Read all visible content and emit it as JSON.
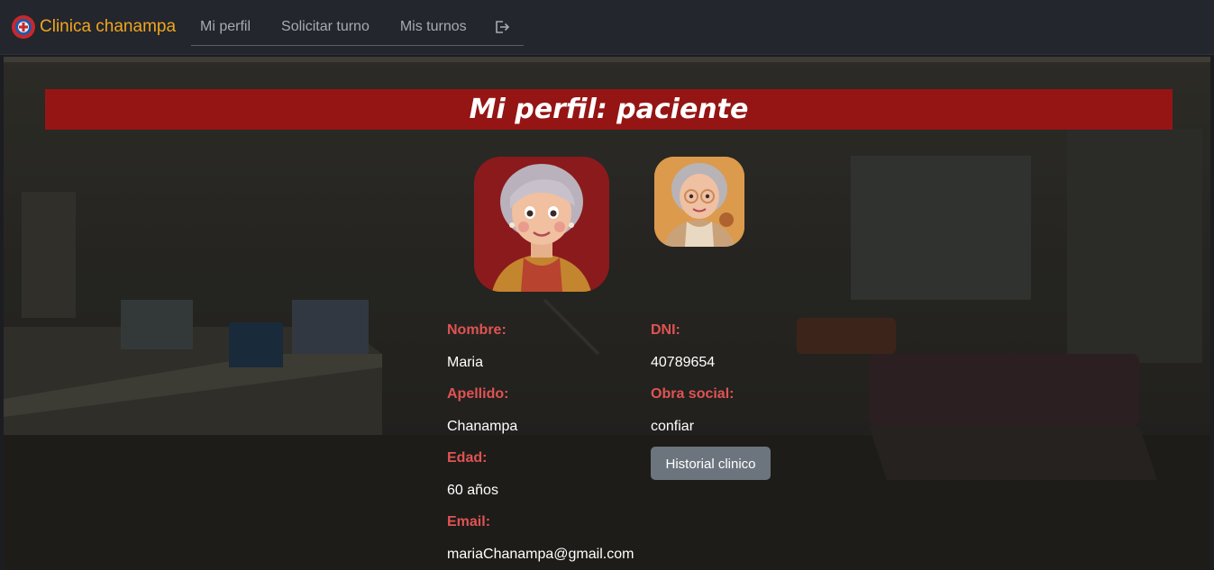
{
  "navbar": {
    "brand": "Clinica chanampa",
    "links": [
      "Mi perfil",
      "Solicitar turno",
      "Mis turnos"
    ],
    "logout_icon": "logout-icon"
  },
  "page": {
    "title": "Mi perfil: paciente"
  },
  "profile": {
    "labels": {
      "nombre": "Nombre:",
      "apellido": "Apellido:",
      "edad": "Edad:",
      "email": "Email:",
      "dni": "DNI:",
      "obra_social": "Obra social:"
    },
    "values": {
      "nombre": "Maria",
      "apellido": "Chanampa",
      "edad": "60 años",
      "email": "mariaChanampa@gmail.com",
      "dni": "40789654",
      "obra_social": "confiar"
    },
    "history_button": "Historial clinico"
  },
  "colors": {
    "brand": "#f0a521",
    "title_bar": "#951515",
    "label": "#e05353",
    "button": "#6c757d"
  }
}
